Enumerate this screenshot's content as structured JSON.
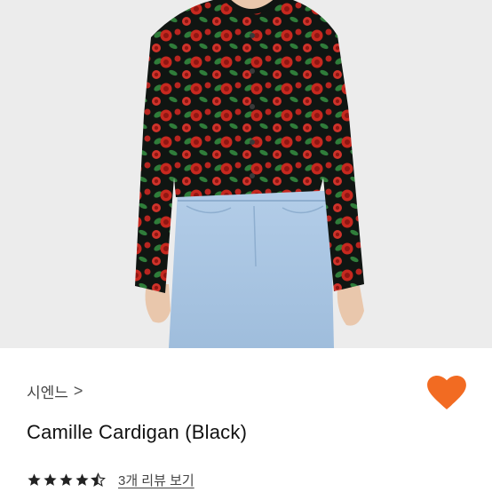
{
  "product": {
    "brand": "시엔느",
    "brand_chevron": ">",
    "name": "Camille Cardigan (Black)",
    "rating": 4.5,
    "review_link": "3개 리뷰 보기",
    "favorited": true
  },
  "colors": {
    "accent": "#f26b22",
    "star": "#222222",
    "photo_bg": "#ececec",
    "cardigan": "#101512",
    "rose": "#c7281f",
    "leaf": "#2f7d3a",
    "jeans": "#a8c4e2",
    "skin": "#e9c7ac"
  },
  "icons": {
    "favorite": "heart-icon",
    "rating": "star-icon"
  }
}
